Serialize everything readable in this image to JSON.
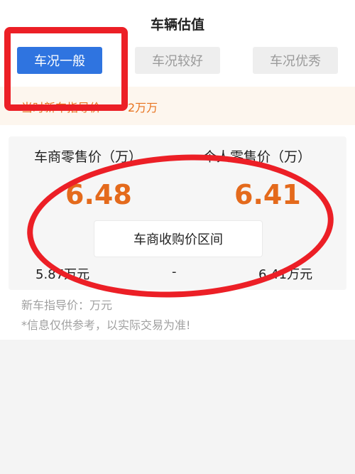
{
  "header": {
    "title": "车辆估值"
  },
  "tabs": [
    {
      "label": "车况一般",
      "active": true
    },
    {
      "label": "车况较好",
      "active": false
    },
    {
      "label": "车况优秀",
      "active": false
    }
  ],
  "price_strip": {
    "label": "当时新车指导价",
    "amount": "2万万"
  },
  "estimate": {
    "dealer_retail_label": "车商零售价（万）",
    "dealer_retail_value": "6.48",
    "private_retail_label": "个人零售价（万）",
    "private_retail_value": "6.41",
    "buyback_button_label": "车商收购价区间",
    "range_low": "5.87万元",
    "range_sep": "-",
    "range_high": "6.41万元"
  },
  "notes": {
    "new_car_price": "新车指导价：万元",
    "disclaimer": "*信息仅供参考，以实际交易为准!"
  },
  "colors": {
    "accent_blue": "#2f74e0",
    "value_orange": "#e46a1c",
    "annotation_red": "#ec1f26"
  }
}
